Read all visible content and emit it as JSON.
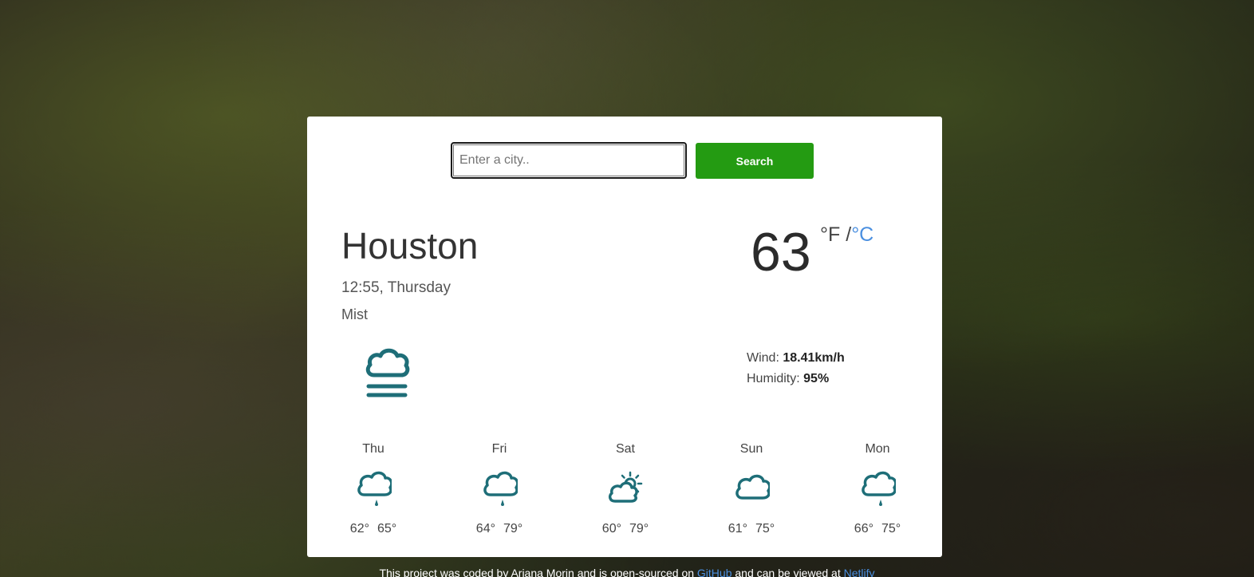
{
  "search": {
    "placeholder": "Enter a city..",
    "button_label": "Search"
  },
  "current": {
    "city": "Houston",
    "datetime": "12:55, Thursday",
    "condition": "Mist",
    "icon": "mist-icon",
    "temperature": "63",
    "unit_f": "°F",
    "unit_separator": "/",
    "unit_c": "°C",
    "wind_label": "Wind:",
    "wind_value": "18.41km/h",
    "humidity_label": "Humidity:",
    "humidity_value": "95%"
  },
  "forecast": [
    {
      "day": "Thu",
      "icon": "rain-icon",
      "min": "62°",
      "max": "65°"
    },
    {
      "day": "Fri",
      "icon": "rain-icon",
      "min": "64°",
      "max": "79°"
    },
    {
      "day": "Sat",
      "icon": "partly-cloudy-icon",
      "min": "60°",
      "max": "79°"
    },
    {
      "day": "Sun",
      "icon": "cloud-icon",
      "min": "61°",
      "max": "75°"
    },
    {
      "day": "Mon",
      "icon": "rain-icon",
      "min": "66°",
      "max": "75°"
    }
  ],
  "footer": {
    "text_before": "This project was coded by Ariana Morin and is open-sourced on",
    "github_link": "GitHub",
    "text_middle": "and can be viewed at",
    "netlify_link": "Netlify"
  },
  "colors": {
    "accent_green": "#249b12",
    "icon_teal": "#1e6e78",
    "link_blue": "#4a8fe0"
  }
}
